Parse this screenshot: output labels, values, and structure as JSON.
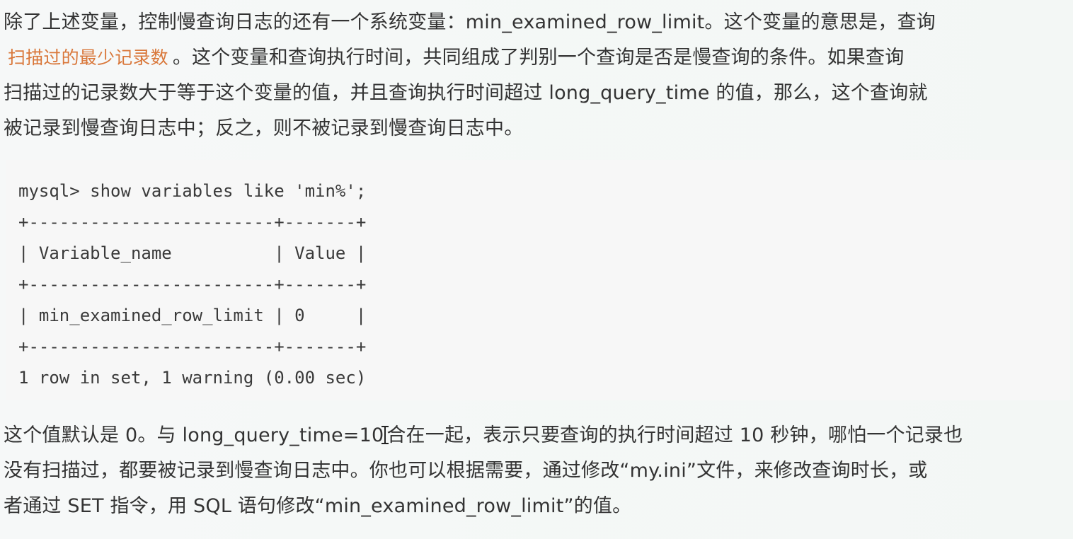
{
  "intro": {
    "line1": "除了上述变量，控制慢查询日志的还有一个系统变量：min_examined_row_limit。这个变量的意思是，查询",
    "line2_highlight": "扫描过的最少记录数",
    "line2_rest": "。这个变量和查询执行时间，共同组成了判别一个查询是否是慢查询的条件。如果查询",
    "line3": "扫描过的记录数大于等于这个变量的值，并且查询执行时间超过 long_query_time 的值，那么，这个查询就",
    "line4": "被记录到慢查询日志中；反之，则不被记录到慢查询日志中。"
  },
  "code": {
    "lines": [
      "mysql> show variables like 'min%';",
      "+------------------------+-------+",
      "| Variable_name          | Value |",
      "+------------------------+-------+",
      "| min_examined_row_limit | 0     |",
      "+------------------------+-------+",
      "1 row in set, 1 warning (0.00 sec)"
    ]
  },
  "outro": {
    "line1_a": "这个值默认是 0。与 long_query_time=10",
    "line1_b": "合在一起，表示只要查询的执行时间超过 10 秒钟，哪怕一个记录也",
    "line2": "没有扫描过，都要被记录到慢查询日志中。你也可以根据需要，通过修改“my.ini”文件，来修改查询时长，或",
    "line3": "者通过 SET 指令，用 SQL 语句修改“min_examined_row_limit”的值。"
  },
  "colors": {
    "highlight": "#d9773a",
    "text": "#333333",
    "code_bg": "#f7f7f7"
  }
}
